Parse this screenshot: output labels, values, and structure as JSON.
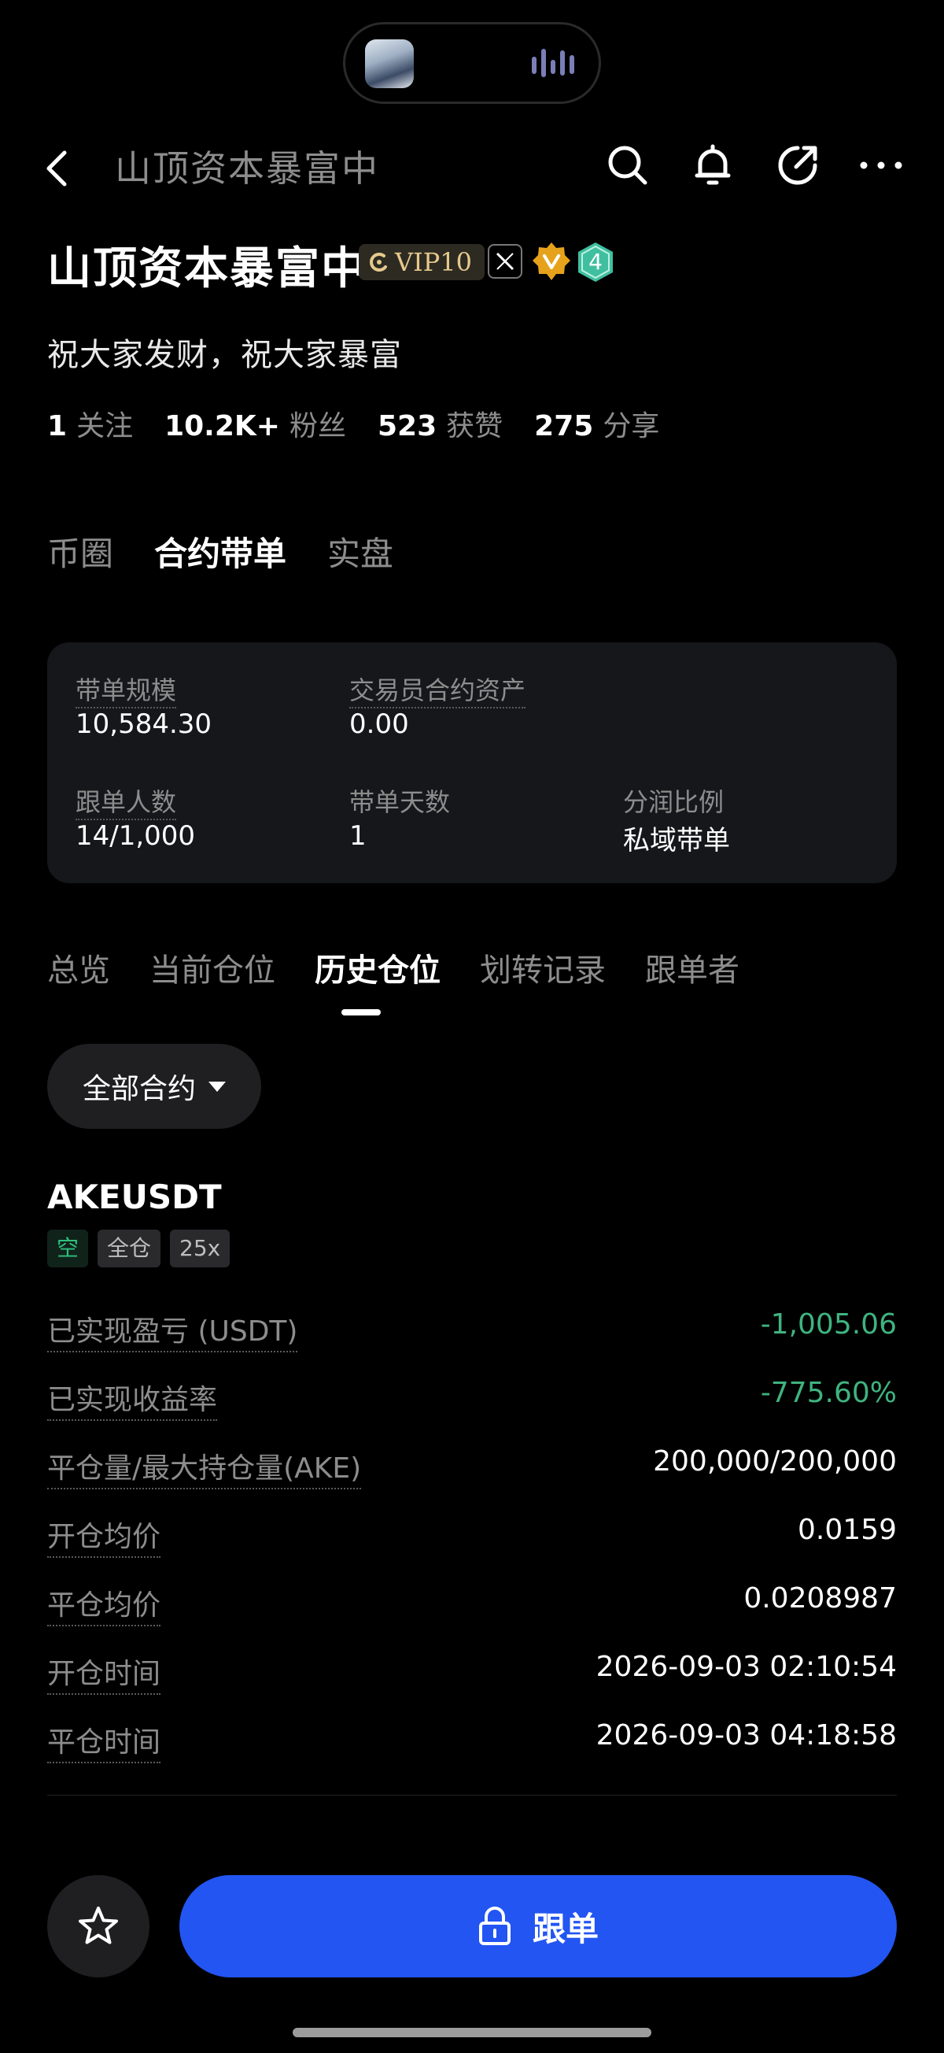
{
  "header": {
    "title": "山顶资本暴富中",
    "icons": [
      "back-icon",
      "search-icon",
      "bell-icon",
      "share-icon",
      "more-icon"
    ]
  },
  "profile": {
    "name": "山顶资本暴富中",
    "vip_label": "VIP10",
    "level": "4",
    "bio": "祝大家发财，祝大家暴富",
    "stats": [
      {
        "value": "1",
        "label": "关注"
      },
      {
        "value": "10.2K+",
        "label": "粉丝"
      },
      {
        "value": "523",
        "label": "获赞"
      },
      {
        "value": "275",
        "label": "分享"
      }
    ]
  },
  "category_tabs": [
    {
      "label": "币圈",
      "active": false
    },
    {
      "label": "合约带单",
      "active": true
    },
    {
      "label": "实盘",
      "active": false
    }
  ],
  "card": {
    "scale_label": "带单规模",
    "scale_value": "10,584.30",
    "assets_label": "交易员合约资产",
    "assets_value": "0.00",
    "followers_label": "跟单人数",
    "followers_value": "14/1,000",
    "days_label": "带单天数",
    "days_value": "1",
    "share_label": "分润比例",
    "share_value": "私域带单"
  },
  "sub_tabs": [
    {
      "label": "总览",
      "active": false
    },
    {
      "label": "当前仓位",
      "active": false
    },
    {
      "label": "历史仓位",
      "active": true
    },
    {
      "label": "划转记录",
      "active": false
    },
    {
      "label": "跟单者",
      "active": false
    }
  ],
  "filter": {
    "label": "全部合约"
  },
  "position": {
    "pair": "AKEUSDT",
    "tags": [
      "空",
      "全仓",
      "25x"
    ],
    "rows": [
      {
        "label": "已实现盈亏 (USDT)",
        "value": "-1,005.06"
      },
      {
        "label": "已实现收益率",
        "value": "-775.60%"
      },
      {
        "label": "平仓量/最大持仓量(AKE)",
        "value": "200,000/200,000"
      },
      {
        "label": "开仓均价",
        "value": "0.0159"
      },
      {
        "label": "平仓均价",
        "value": "0.0208987"
      },
      {
        "label": "开仓时间",
        "value": "2026-09-03 02:10:54"
      },
      {
        "label": "平仓时间",
        "value": "2026-09-03 04:18:58"
      }
    ]
  },
  "bottom": {
    "follow_label": "跟单"
  },
  "colors": {
    "accent": "#2255f2",
    "profit_negative": "#3fb37f",
    "vip_gold": "#e6c98c"
  }
}
